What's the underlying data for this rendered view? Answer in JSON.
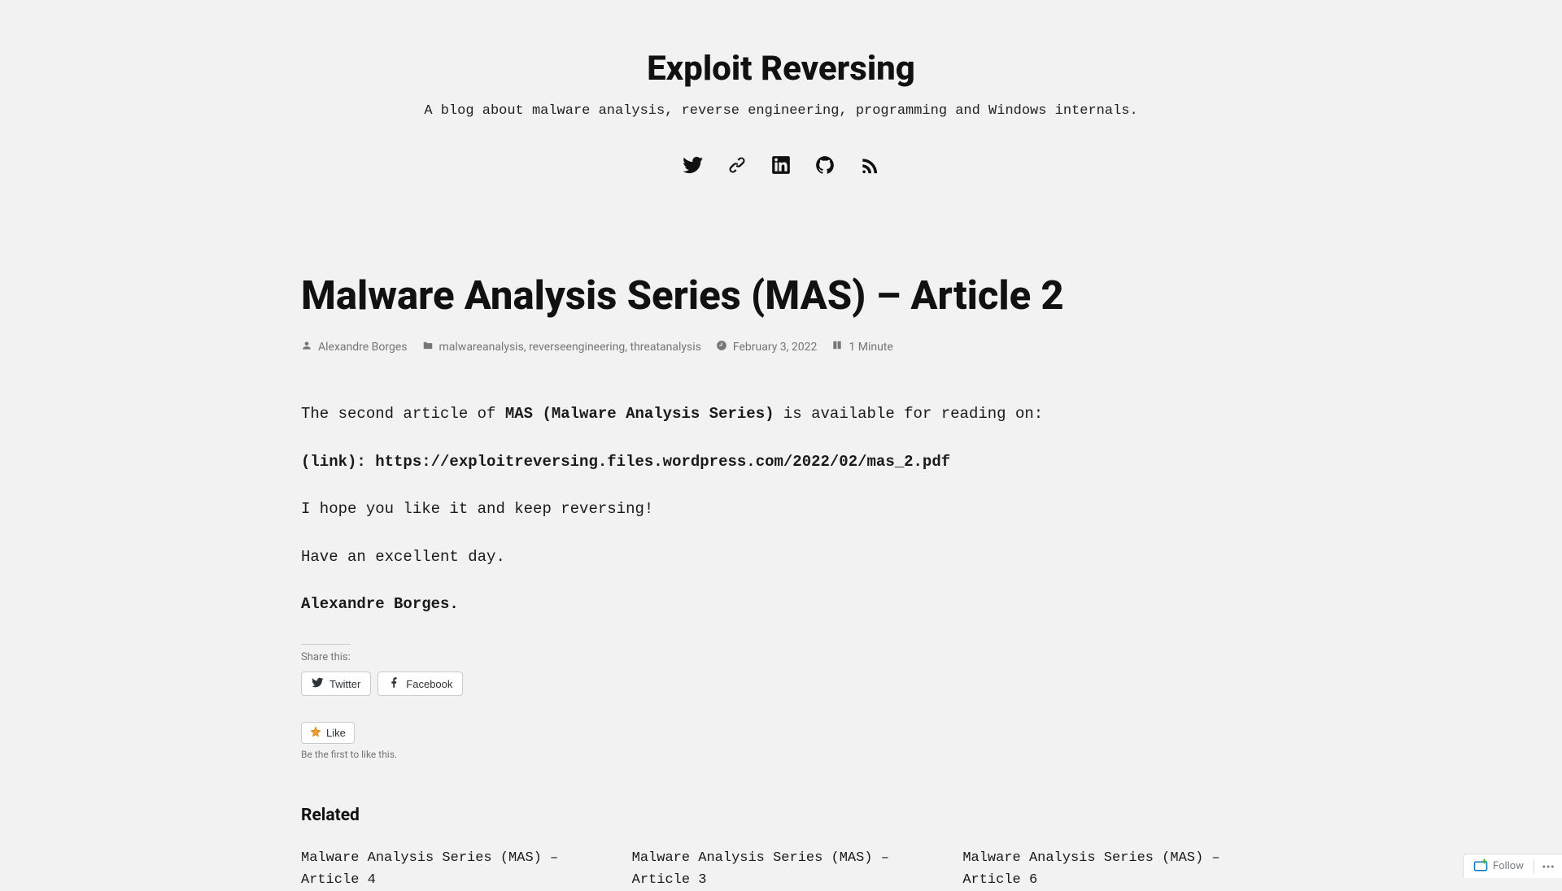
{
  "site": {
    "title": "Exploit Reversing",
    "tagline": "A blog about malware analysis, reverse engineering, programming and Windows internals."
  },
  "social": {
    "twitter": "Twitter",
    "link": "Link",
    "linkedin": "LinkedIn",
    "github": "GitHub",
    "rss": "RSS"
  },
  "post": {
    "title": "Malware Analysis Series (MAS) – Article 2",
    "author": "Alexandre Borges",
    "categories": [
      "malwareanalysis",
      "reverseengineering",
      "threatanalysis"
    ],
    "date": "February 3, 2022",
    "read_time": "1 Minute",
    "body": {
      "p1_pre": "The second article of ",
      "p1_strong": "MAS (Malware Analysis Series)",
      "p1_post": " is available for reading on:",
      "p2_label": "(link): ",
      "p2_url": "https://exploitreversing.files.wordpress.com/2022/02/mas_2.pdf",
      "p3": "I hope you like it and keep reversing!",
      "p4": "Have an excellent day.",
      "p5": "Alexandre Borges."
    }
  },
  "share": {
    "label": "Share this:",
    "twitter": "Twitter",
    "facebook": "Facebook"
  },
  "like": {
    "button": "Like",
    "caption": "Be the first to like this."
  },
  "related": {
    "heading": "Related",
    "items": [
      {
        "title": "Malware Analysis Series (MAS) – Article 4"
      },
      {
        "title": "Malware Analysis Series (MAS) – Article 3"
      },
      {
        "title": "Malware Analysis Series (MAS) – Article 6"
      }
    ]
  },
  "adminbar": {
    "follow": "Follow"
  }
}
